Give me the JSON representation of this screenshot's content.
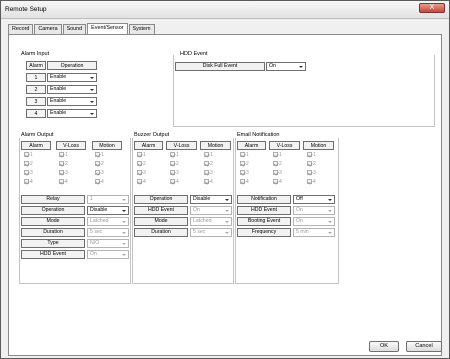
{
  "window": {
    "title": "Remote Setup",
    "close_label": "X"
  },
  "tabs": [
    {
      "label": "Record"
    },
    {
      "label": "Camera"
    },
    {
      "label": "Sound"
    },
    {
      "label": "Event/Sensor"
    },
    {
      "label": "System"
    }
  ],
  "active_tab": "Event/Sensor",
  "alarm_input": {
    "title": "Alarm Input",
    "headers": [
      "Alarm",
      "Operation"
    ],
    "rows": [
      {
        "num": "1",
        "value": "Enable"
      },
      {
        "num": "2",
        "value": "Enable"
      },
      {
        "num": "3",
        "value": "Enable"
      },
      {
        "num": "4",
        "value": "Enable"
      }
    ]
  },
  "hdd_event": {
    "title": "HDD Event",
    "label": "Disk Full Event",
    "value": "On"
  },
  "alarm_output": {
    "title": "Alarm Output",
    "headers": [
      "Alarm",
      "V-Loss",
      "Motion"
    ],
    "check_numbers": [
      "1",
      "2",
      "3",
      "4"
    ],
    "fields": [
      {
        "label": "Relay",
        "value": "1",
        "disabled": true
      },
      {
        "label": "Operation",
        "value": "Disable",
        "disabled": false
      },
      {
        "label": "Mode",
        "value": "Latched",
        "disabled": true
      },
      {
        "label": "Duration",
        "value": "5 sec",
        "disabled": true
      },
      {
        "label": "Type",
        "value": "N/O",
        "disabled": true
      },
      {
        "label": "HDD Event",
        "value": "On",
        "disabled": true
      }
    ]
  },
  "buzzer_output": {
    "title": "Buzzer Output",
    "headers": [
      "Alarm",
      "V-Loss",
      "Motion"
    ],
    "check_numbers": [
      "1",
      "2",
      "3",
      "4"
    ],
    "fields": [
      {
        "label": "Operation",
        "value": "Disable",
        "disabled": false
      },
      {
        "label": "HDD Event",
        "value": "On",
        "disabled": true
      },
      {
        "label": "Mode",
        "value": "Latched",
        "disabled": true
      },
      {
        "label": "Duration",
        "value": "5 sec",
        "disabled": true
      }
    ]
  },
  "email_notification": {
    "title": "Email Notification",
    "headers": [
      "Alarm",
      "V-Loss",
      "Motion"
    ],
    "check_numbers": [
      "1",
      "2",
      "3",
      "4"
    ],
    "fields": [
      {
        "label": "Notification",
        "value": "Off",
        "disabled": false
      },
      {
        "label": "HDD Event",
        "value": "On",
        "disabled": true
      },
      {
        "label": "Booting Event",
        "value": "On",
        "disabled": true
      },
      {
        "label": "Frequency",
        "value": "5 min",
        "disabled": true
      }
    ]
  },
  "buttons": {
    "ok": "OK",
    "cancel": "Cancel"
  }
}
